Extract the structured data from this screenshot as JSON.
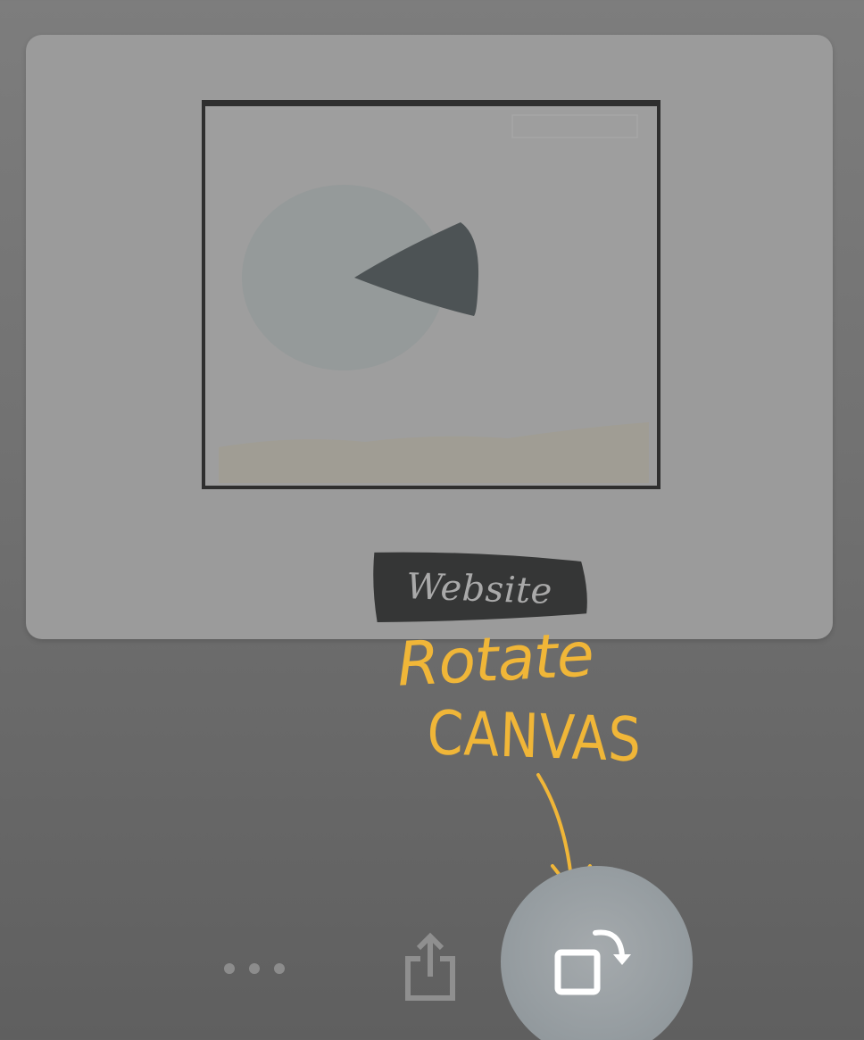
{
  "sketch": {
    "label": "Website"
  },
  "annotation": {
    "line1": "Rotate",
    "line2": "CANVAS"
  },
  "toolbar": {
    "more_icon": "more-dots-icon",
    "share_icon": "share-icon",
    "rotate_icon": "rotate-canvas-icon"
  },
  "colors": {
    "annotation": "#f0b638",
    "card": "#9b9b9b",
    "highlight_circle": "#959ca0"
  }
}
